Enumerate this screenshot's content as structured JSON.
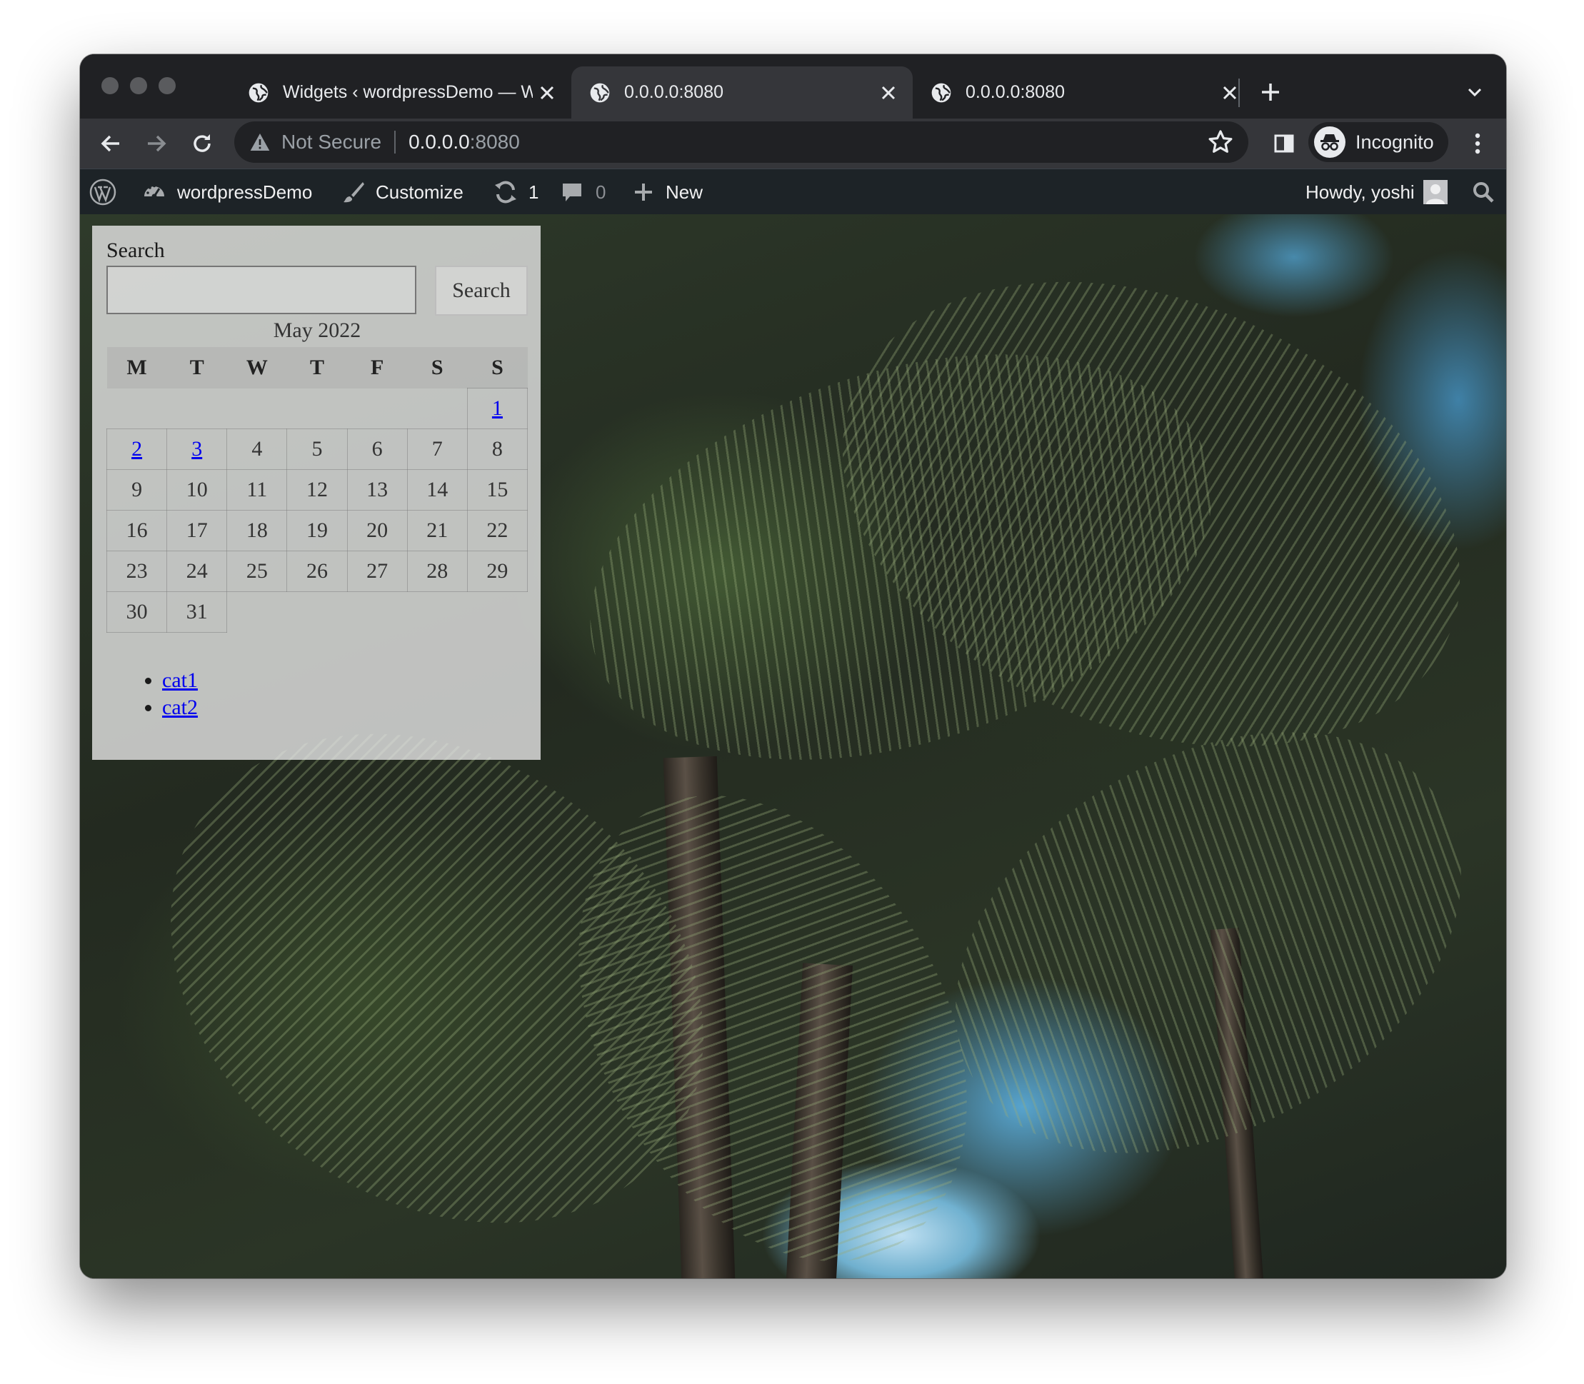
{
  "browser": {
    "tabs": [
      {
        "title": "Widgets ‹ wordpressDemo — W",
        "active": false
      },
      {
        "title": "0.0.0.0:8080",
        "active": true
      },
      {
        "title": "0.0.0.0:8080",
        "active": false
      }
    ],
    "address": {
      "security_label": "Not Secure",
      "host": "0.0.0.0",
      "port": ":8080"
    },
    "profile_label": "Incognito"
  },
  "admin_bar": {
    "site_name": "wordpressDemo",
    "customize_label": "Customize",
    "updates_count": "1",
    "comments_count": "0",
    "new_label": "New",
    "greeting": "Howdy, yoshi"
  },
  "widgets": {
    "search": {
      "label": "Search",
      "input_value": "",
      "button_label": "Search"
    },
    "calendar": {
      "caption": "May 2022",
      "weekdays": [
        "M",
        "T",
        "W",
        "T",
        "F",
        "S",
        "S"
      ],
      "weeks": [
        [
          "",
          "",
          "",
          "",
          "",
          "",
          "1"
        ],
        [
          "2",
          "3",
          "4",
          "5",
          "6",
          "7",
          "8"
        ],
        [
          "9",
          "10",
          "11",
          "12",
          "13",
          "14",
          "15"
        ],
        [
          "16",
          "17",
          "18",
          "19",
          "20",
          "21",
          "22"
        ],
        [
          "23",
          "24",
          "25",
          "26",
          "27",
          "28",
          "29"
        ],
        [
          "30",
          "31",
          "",
          "",
          "",
          "",
          ""
        ]
      ],
      "linked_days": [
        "1",
        "2",
        "3"
      ]
    },
    "categories": [
      "cat1",
      "cat2"
    ]
  },
  "colors": {
    "tab_strip": "#202124",
    "toolbar": "#35363a",
    "admin_bar": "#1d2327",
    "link": "#0000ee"
  },
  "icons": [
    "globe-icon",
    "close-icon",
    "plus-icon",
    "chevron-down-icon",
    "back-arrow-icon",
    "forward-arrow-icon",
    "reload-icon",
    "warning-icon",
    "star-icon",
    "side-panel-icon",
    "incognito-icon",
    "menu-dots-icon",
    "wordpress-logo-icon",
    "dashboard-icon",
    "brush-icon",
    "updates-icon",
    "comment-icon",
    "search-icon"
  ]
}
